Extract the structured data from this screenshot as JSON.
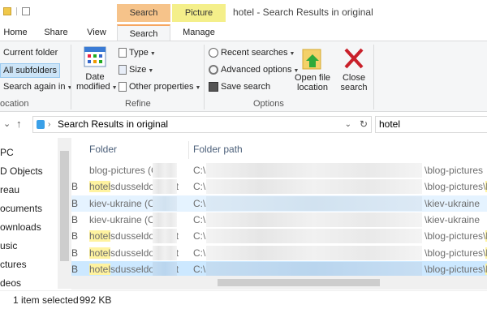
{
  "window": {
    "title": "hotel - Search Results in original",
    "context_tabs": [
      "Search Tools",
      "Picture Tools"
    ],
    "context_colors": {
      "search": "#f6c38a",
      "picture": "#f4ef8a"
    }
  },
  "ribbon_tabs": [
    "Home",
    "Share",
    "View",
    "Search",
    "Manage"
  ],
  "ribbon": {
    "location": {
      "current_folder": "Current folder",
      "all_subfolders": "All subfolders",
      "search_again": "Search again in",
      "label": "ocation"
    },
    "refine": {
      "date_modified_line1": "Date",
      "date_modified_line2": "modified",
      "type": "Type",
      "size": "Size",
      "other_properties": "Other properties",
      "label": "Refine"
    },
    "options": {
      "recent_searches": "Recent searches",
      "advanced_options": "Advanced options",
      "save_search": "Save search",
      "open_file_location_line1": "Open file",
      "open_file_location_line2": "location",
      "close_search_line1": "Close",
      "close_search_line2": "search",
      "label": "Options"
    }
  },
  "address": {
    "path": "Search Results in original",
    "search_query": "hotel"
  },
  "nav": {
    "items": [
      "PC",
      "D Objects",
      "reau",
      "ocuments",
      "ownloads",
      "usic",
      "ctures",
      "deos"
    ]
  },
  "columns": {
    "folder": "Folder",
    "folder_path": "Folder path"
  },
  "rows": [
    {
      "mark": "",
      "highlight": "",
      "name": "blog-pictures (C:\\",
      "path_start": "C:\\",
      "path_end": "\\blog-pictures",
      "tail": "",
      "state": "normal"
    },
    {
      "mark": "B",
      "highlight": "hotel",
      "name": "sdusseldorfbest...",
      "path_start": "C:\\",
      "path_end": "\\blog-pictures\\",
      "tail": "h",
      "state": "normal"
    },
    {
      "mark": "B",
      "highlight": "",
      "name": "kiev-ukraine (C:\\",
      "path_start": "C:\\",
      "path_end": "\\kiev-ukraine",
      "tail": "",
      "state": "hover"
    },
    {
      "mark": "B",
      "highlight": "",
      "name": "kiev-ukraine (C:\\",
      "path_start": "C:\\",
      "path_end": "\\kiev-ukraine",
      "tail": "",
      "state": "normal"
    },
    {
      "mark": "B",
      "highlight": "hotel",
      "name": "sdusseldorfbest...",
      "path_start": "C:\\",
      "path_end": "\\blog-pictures\\",
      "tail": "h",
      "state": "normal"
    },
    {
      "mark": "B",
      "highlight": "hotel",
      "name": "sdusseldorfbest...",
      "path_start": "C:\\",
      "path_end": "\\blog-pictures\\",
      "tail": "h",
      "state": "normal"
    },
    {
      "mark": "B",
      "highlight": "hotel",
      "name": "sdusseldorfbest...",
      "path_start": "C:\\",
      "path_end": "\\blog-pictures\\",
      "tail": "h",
      "state": "selected"
    }
  ],
  "status": {
    "count": "1 item selected",
    "size": "992 KB"
  }
}
